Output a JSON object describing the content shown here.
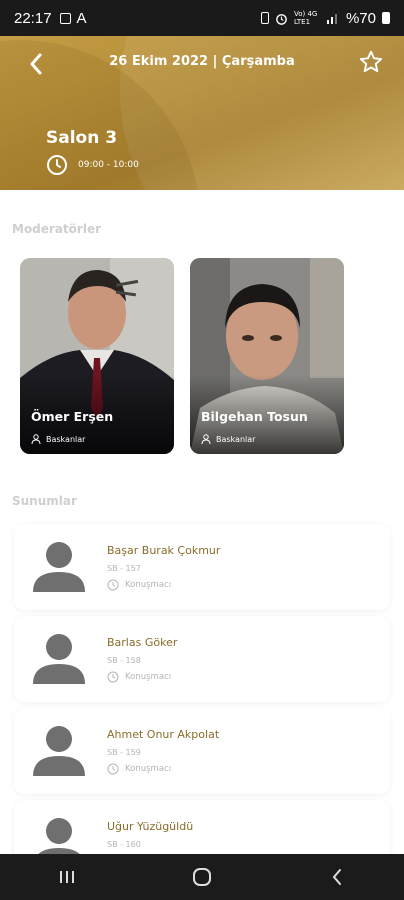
{
  "status_bar": {
    "time": "22:17",
    "letter_icon": "A",
    "network_text": "Vo) 4G LTE1",
    "battery_text": "%70"
  },
  "header": {
    "date": "26 Ekim 2022 | Çarşamba",
    "hall": "Salon 3",
    "time_range": "09:00 - 10:00"
  },
  "moderators": {
    "section_title": "Moderatörler",
    "items": [
      {
        "name": "Ömer Erşen",
        "role": "Baskanlar"
      },
      {
        "name": "Bilgehan Tosun",
        "role": "Baskanlar"
      }
    ]
  },
  "presentations": {
    "section_title": "Sunumlar",
    "items": [
      {
        "name": "Başar Burak Çokmur",
        "code": "SB - 157",
        "role": "Konuşmacı"
      },
      {
        "name": "Barlas Göker",
        "code": "SB - 158",
        "role": "Konuşmacı"
      },
      {
        "name": "Ahmet Onur Akpolat",
        "code": "SB - 159",
        "role": "Konuşmacı"
      },
      {
        "name": "Uğur Yüzügüldü",
        "code": "SB - 160",
        "role": ""
      }
    ]
  },
  "colors": {
    "accent_gold": "#b8913a",
    "name_brown": "#8a6d2a"
  }
}
